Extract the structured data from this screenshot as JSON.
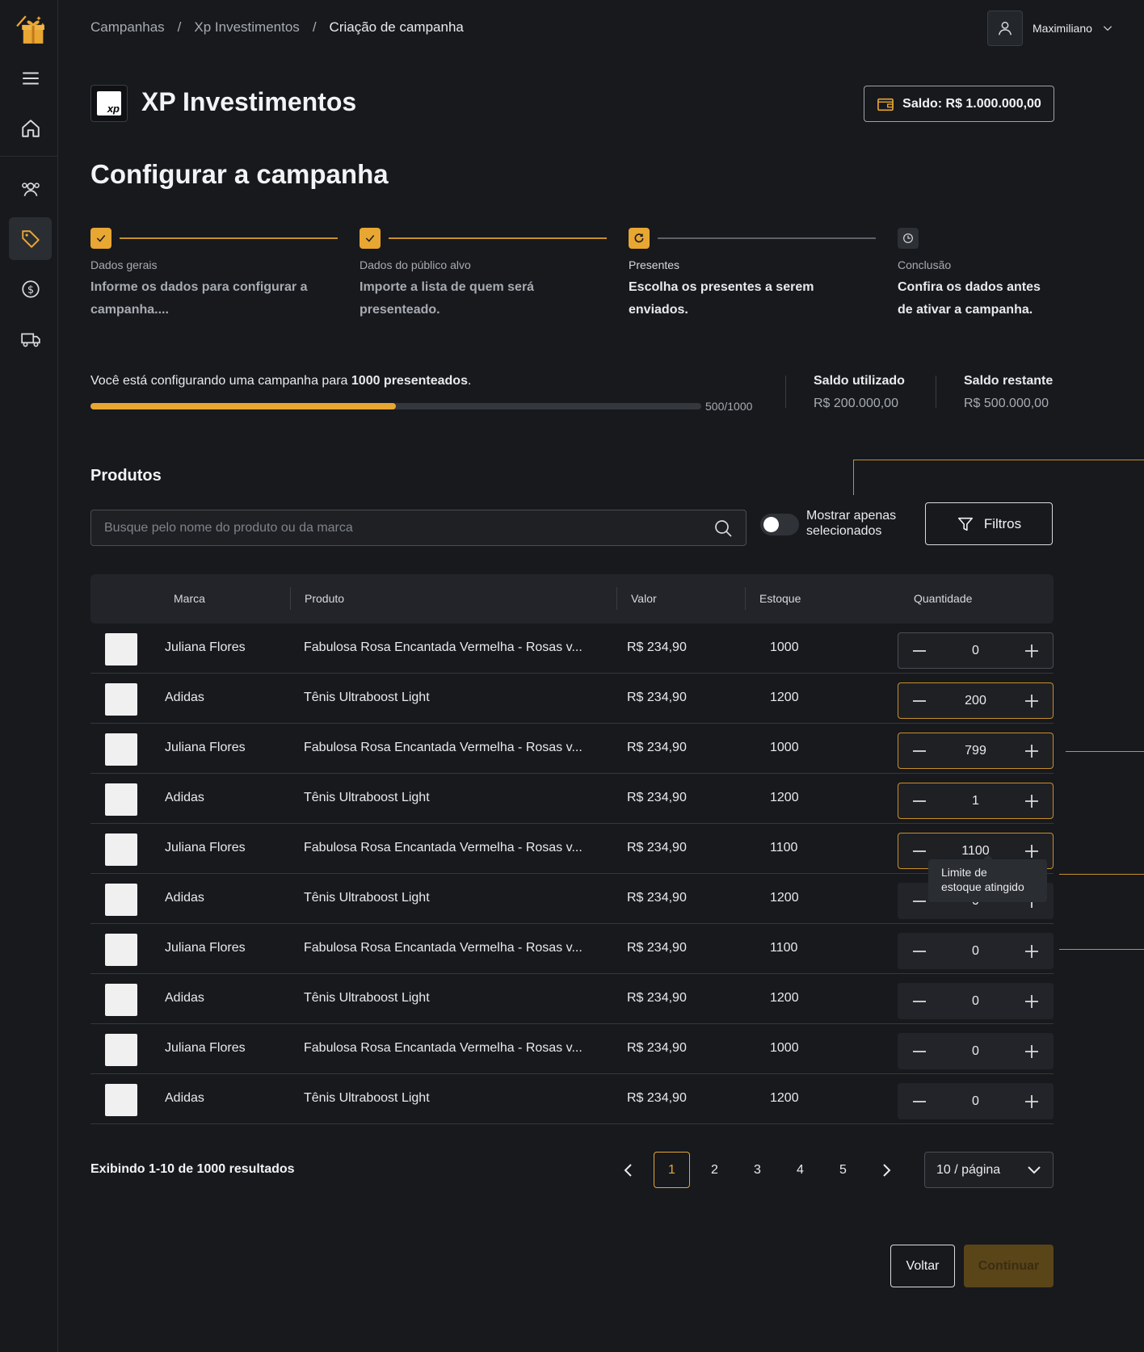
{
  "breadcrumb": {
    "item1": "Campanhas",
    "sep": "/",
    "item2": "Xp Investimentos",
    "current": "Criação de campanha"
  },
  "user": {
    "name": "Maximiliano"
  },
  "company": {
    "name": "XP Investimentos",
    "logo_text": "xp"
  },
  "saldo_button": "Saldo: R$ 1.000.000,00",
  "page_title": "Configurar a campanha",
  "steps": [
    {
      "label": "Dados gerais",
      "desc_line1": "Informe os dados para configurar a",
      "desc_line2": "campanha....",
      "status": "done"
    },
    {
      "label": "Dados do público alvo",
      "desc_line1": "Importe a lista de quem será",
      "desc_line2": "presenteado.",
      "status": "done"
    },
    {
      "label": "Presentes",
      "desc_line1": "Escolha os presentes a serem",
      "desc_line2": "enviados.",
      "status": "current"
    },
    {
      "label": "Conclusão",
      "desc_line1": "Confira os dados antes",
      "desc_line2": "de ativar a campanha.",
      "status": "todo"
    }
  ],
  "progress": {
    "text_before": "Você está configurando uma campanha para ",
    "text_bold": "1000 presenteados",
    "text_after": ".",
    "count": "500/1000",
    "value": 0.5
  },
  "stats": {
    "used_label": "Saldo utilizado",
    "used_value": "R$ 200.000,00",
    "remaining_label": "Saldo restante",
    "remaining_value": "R$ 500.000,00"
  },
  "products": {
    "title": "Produtos",
    "search_placeholder": "Busque pelo nome do produto ou da marca",
    "toggle_label_line1": "Mostrar apenas",
    "toggle_label_line2": "selecionados",
    "filter_label": "Filtros"
  },
  "table": {
    "headers": {
      "brand": "Marca",
      "product": "Produto",
      "value": "Valor",
      "stock": "Estoque",
      "quantity": "Quantidade"
    },
    "rows": [
      {
        "brand": "Juliana Flores",
        "product": "Fabulosa Rosa Encantada Vermelha - Rosas v...",
        "value": "R$ 234,90",
        "stock": "1000",
        "qty": "0"
      },
      {
        "brand": "Adidas",
        "product": "Tênis Ultraboost Light",
        "value": "R$ 234,90",
        "stock": "1200",
        "qty": "200"
      },
      {
        "brand": "Juliana Flores",
        "product": "Fabulosa Rosa Encantada Vermelha - Rosas v...",
        "value": "R$ 234,90",
        "stock": "1000",
        "qty": "799"
      },
      {
        "brand": "Adidas",
        "product": "Tênis Ultraboost Light",
        "value": "R$ 234,90",
        "stock": "1200",
        "qty": "1"
      },
      {
        "brand": "Juliana Flores",
        "product": "Fabulosa Rosa Encantada Vermelha - Rosas v...",
        "value": "R$ 234,90",
        "stock": "1100",
        "qty": "1100"
      },
      {
        "brand": "Adidas",
        "product": "Tênis Ultraboost Light",
        "value": "R$ 234,90",
        "stock": "1200",
        "qty": "0"
      },
      {
        "brand": "Juliana Flores",
        "product": "Fabulosa Rosa Encantada Vermelha - Rosas v...",
        "value": "R$ 234,90",
        "stock": "1100",
        "qty": "0"
      },
      {
        "brand": "Adidas",
        "product": "Tênis Ultraboost Light",
        "value": "R$ 234,90",
        "stock": "1200",
        "qty": "0"
      },
      {
        "brand": "Juliana Flores",
        "product": "Fabulosa Rosa Encantada Vermelha - Rosas v...",
        "value": "R$ 234,90",
        "stock": "1000",
        "qty": "0"
      },
      {
        "brand": "Adidas",
        "product": "Tênis Ultraboost Light",
        "value": "R$ 234,90",
        "stock": "1200",
        "qty": "0"
      }
    ],
    "tooltip_line1": "Limite de",
    "tooltip_line2": "estoque atingido"
  },
  "pagination": {
    "showing": "Exibindo 1-10 de 1000 resultados",
    "pages": [
      "1",
      "2",
      "3",
      "4",
      "5"
    ],
    "current": "1",
    "per_page": "10 / página"
  },
  "actions": {
    "back": "Voltar",
    "continue": "Continuar"
  },
  "colors": {
    "accent": "#e8a632",
    "background": "#17191d",
    "surface": "#222429"
  }
}
